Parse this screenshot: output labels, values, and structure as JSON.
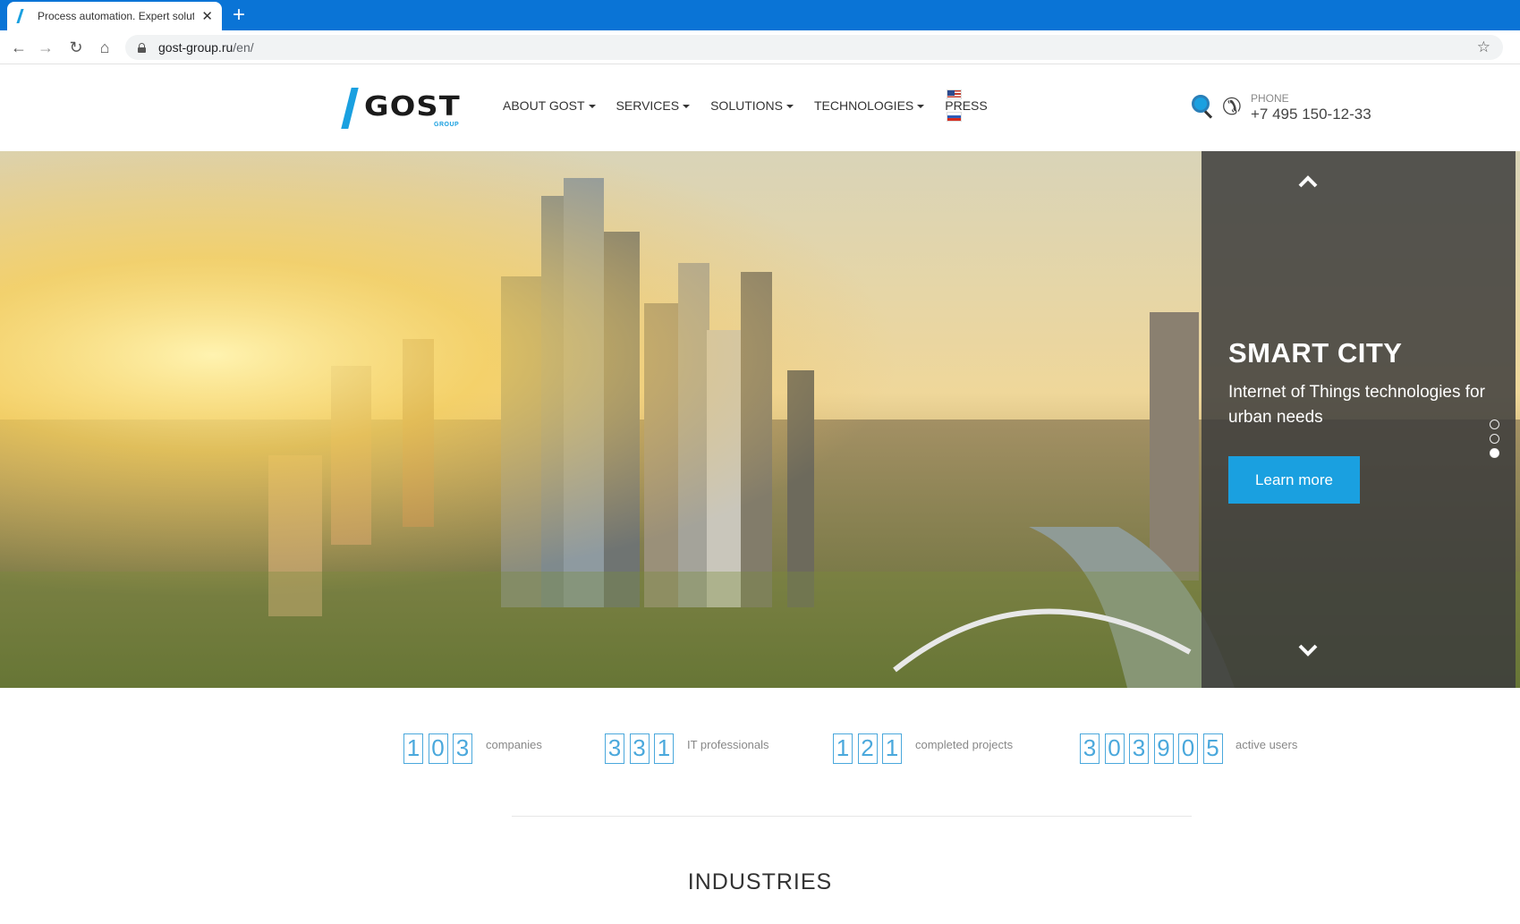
{
  "browser": {
    "tab_title": "Process automation. Expert solut",
    "new_tab": "+",
    "close": "✕",
    "url_host": "gost-group.ru",
    "url_path": "/en/"
  },
  "header": {
    "logo_text": "GOST",
    "logo_sub": "GROUP",
    "nav": [
      "ABOUT GOST",
      "SERVICES",
      "SOLUTIONS",
      "TECHNOLOGIES",
      "PRESS"
    ],
    "phone_label": "PHONE",
    "phone_number": "+7 495 150-12-33"
  },
  "hero": {
    "title": "SMART CITY",
    "subtitle": "Internet of Things technologies for urban needs",
    "button": "Learn more",
    "slide_count": 3,
    "active_slide": 3
  },
  "stats": [
    {
      "digits": [
        "1",
        "0",
        "3"
      ],
      "label": "companies"
    },
    {
      "digits": [
        "3",
        "3",
        "1"
      ],
      "label": "IT professionals"
    },
    {
      "digits": [
        "1",
        "2",
        "1"
      ],
      "label": "completed projects"
    },
    {
      "digits": [
        "3",
        "0",
        "3",
        "9",
        "0",
        "5"
      ],
      "label": "active users"
    }
  ],
  "section_title": "INDUSTRIES",
  "colors": {
    "accent": "#1aa0e0",
    "tabbar": "#0a74d6",
    "counter": "#4aa8dc"
  }
}
